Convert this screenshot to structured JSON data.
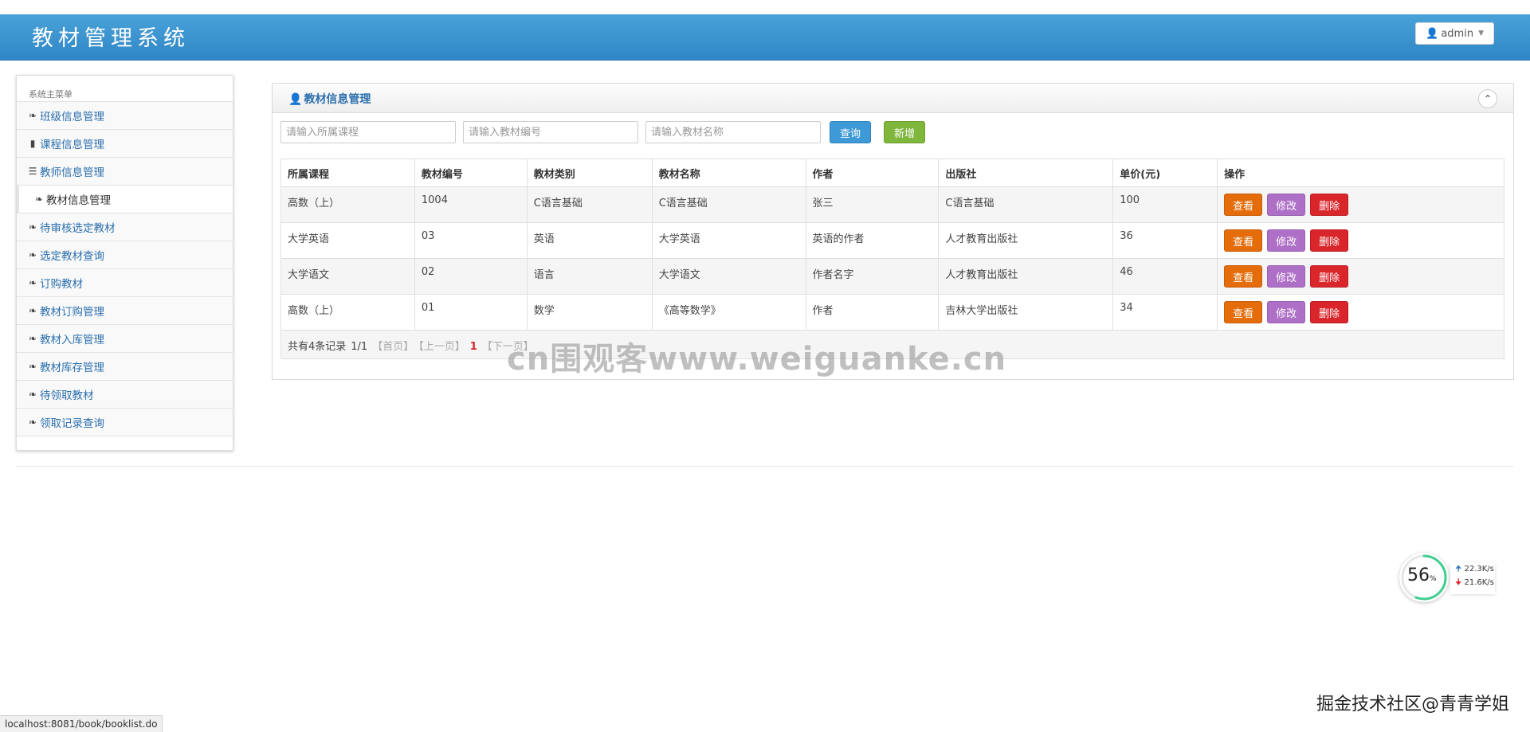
{
  "header": {
    "app_title": "教材管理系统",
    "user_label": "admin"
  },
  "sidebar": {
    "heading": "系统主菜单",
    "items": [
      {
        "label": "班级信息管理",
        "icon": "leaf-icon"
      },
      {
        "label": "课程信息管理",
        "icon": "bookmark-icon"
      },
      {
        "label": "教师信息管理",
        "icon": "list-icon"
      },
      {
        "label": "教材信息管理",
        "icon": "leaf-icon",
        "active": true
      },
      {
        "label": "待审核选定教材",
        "icon": "leaf-icon"
      },
      {
        "label": "选定教材查询",
        "icon": "leaf-icon"
      },
      {
        "label": "订购教材",
        "icon": "leaf-icon"
      },
      {
        "label": "教材订购管理",
        "icon": "leaf-icon"
      },
      {
        "label": "教材入库管理",
        "icon": "leaf-icon"
      },
      {
        "label": "教材库存管理",
        "icon": "leaf-icon"
      },
      {
        "label": "待领取教材",
        "icon": "leaf-icon"
      },
      {
        "label": "领取记录查询",
        "icon": "leaf-icon"
      }
    ]
  },
  "panel": {
    "title": "教材信息管理",
    "search": {
      "course_placeholder": "请输入所属课程",
      "code_placeholder": "请输入教材编号",
      "name_placeholder": "请输入教材名称",
      "query_label": "查询",
      "add_label": "新增"
    },
    "table": {
      "headers": [
        "所属课程",
        "教材编号",
        "教材类别",
        "教材名称",
        "作者",
        "出版社",
        "单价(元)",
        "操作"
      ],
      "rows": [
        {
          "course": "高数（上）",
          "code": "1004",
          "category": "C语言基础",
          "name": "C语言基础",
          "author": "张三",
          "publisher": "C语言基础",
          "price": "100"
        },
        {
          "course": "大学英语",
          "code": "03",
          "category": "英语",
          "name": "大学英语",
          "author": "英语的作者",
          "publisher": "人才教育出版社",
          "price": "36"
        },
        {
          "course": "大学语文",
          "code": "02",
          "category": "语言",
          "name": "大学语文",
          "author": "作者名字",
          "publisher": "人才教育出版社",
          "price": "46"
        },
        {
          "course": "高数（上）",
          "code": "01",
          "category": "数学",
          "name": "《高等数学》",
          "author": "作者",
          "publisher": "吉林大学出版社",
          "price": "34"
        }
      ],
      "actions": {
        "view": "查看",
        "edit": "修改",
        "delete": "删除"
      }
    },
    "pager": {
      "summary": "共有4条记录",
      "page_info": "1/1",
      "first": "【首页】",
      "prev": "【上一页】",
      "current": "1",
      "next": "【下一页】"
    }
  },
  "overlays": {
    "watermark": "cn围观客www.weiguanke.cn",
    "net_percent": "56",
    "net_percent_unit": "%",
    "upload_speed": "22.3K/s",
    "download_speed": "21.6K/s",
    "corner_mark": "掘金技术社区@青青学姐",
    "status_url": "localhost:8081/book/booklist.do"
  },
  "colors": {
    "header": "#3a93d0",
    "link": "#2b6fae",
    "view_btn": "#e46c0a",
    "edit_btn": "#ae6fc7",
    "delete_btn": "#d9262b",
    "query_btn": "#3d9ad6",
    "add_btn": "#7fb63c"
  }
}
